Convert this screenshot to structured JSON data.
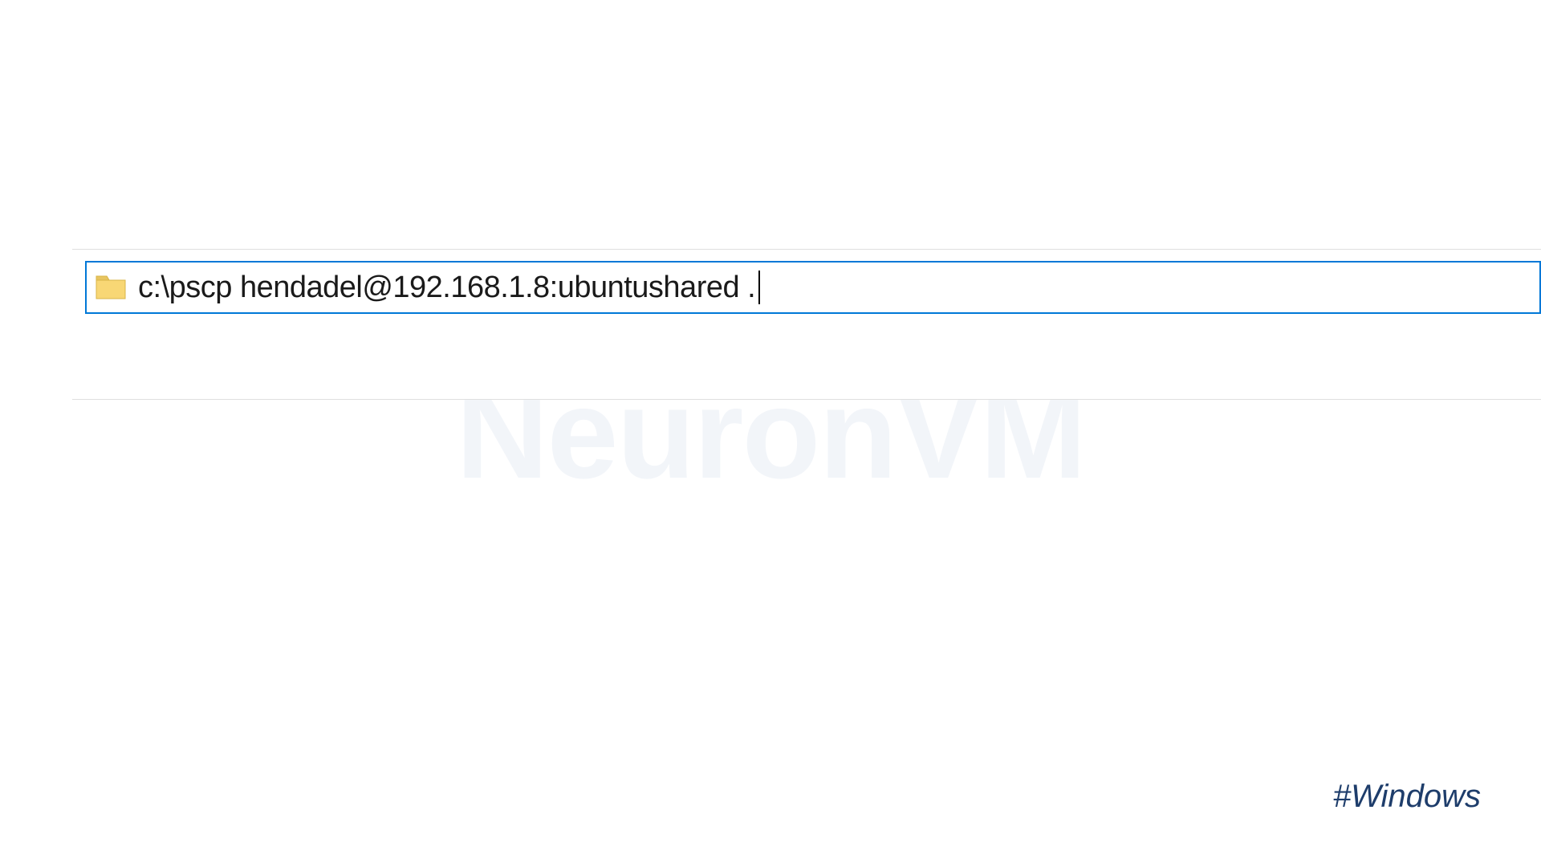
{
  "watermark": {
    "text": "NeuronVM"
  },
  "addressBar": {
    "value": "c:\\pscp hendadel@192.168.1.8:ubuntushared ."
  },
  "hashtag": {
    "text": "#Windows"
  }
}
